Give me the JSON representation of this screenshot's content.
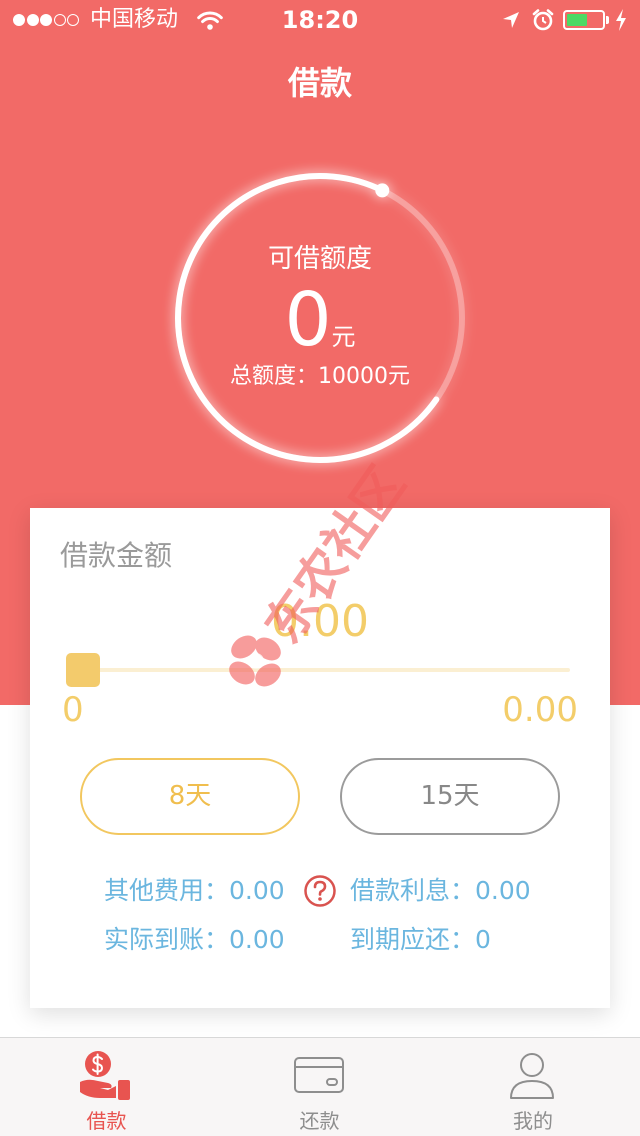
{
  "status_bar": {
    "signal_strength": 3,
    "signal_max": 5,
    "carrier": "中国移动",
    "time": "18:20",
    "battery_level": 0.6,
    "icons": [
      "wifi-icon",
      "location-arrow-icon",
      "alarm-icon",
      "battery-icon",
      "charging-bolt-icon"
    ]
  },
  "header": {
    "title": "借款"
  },
  "gauge": {
    "label": "可借额度",
    "amount": "0",
    "unit": "元",
    "total_label": "总额度：",
    "total_value": "10000元"
  },
  "loan_card": {
    "title": "借款金额",
    "amount": "0.00",
    "slider": {
      "position": 0,
      "min_label": "0",
      "max_label": "0.00"
    },
    "terms": [
      {
        "label": "8天",
        "selected": true
      },
      {
        "label": "15天",
        "selected": false
      }
    ],
    "fees": {
      "other_fees": {
        "label": "其他费用：",
        "value": "0.00"
      },
      "interest": {
        "label": "借款利息：",
        "value": "0.00"
      },
      "actual_received": {
        "label": "实际到账：",
        "value": "0.00"
      },
      "due_amount": {
        "label": "到期应还：",
        "value": "0"
      }
    },
    "help_icon": "question-circle-icon"
  },
  "watermark": {
    "text": "东农社区",
    "logo_icon": "watermark-logo-icon"
  },
  "tab_bar": {
    "tabs": [
      {
        "label": "借款",
        "icon": "dollar-hand-icon",
        "active": true
      },
      {
        "label": "还款",
        "icon": "card-icon",
        "active": false
      },
      {
        "label": "我的",
        "icon": "person-icon",
        "active": false
      }
    ]
  },
  "colors": {
    "primary_red": "#F26A67",
    "accent_yellow": "#F2C75F",
    "info_blue": "#6BB6DF",
    "tab_active": "#E85450",
    "tab_inactive": "#8E8E8E",
    "battery_green": "#4CD964"
  }
}
